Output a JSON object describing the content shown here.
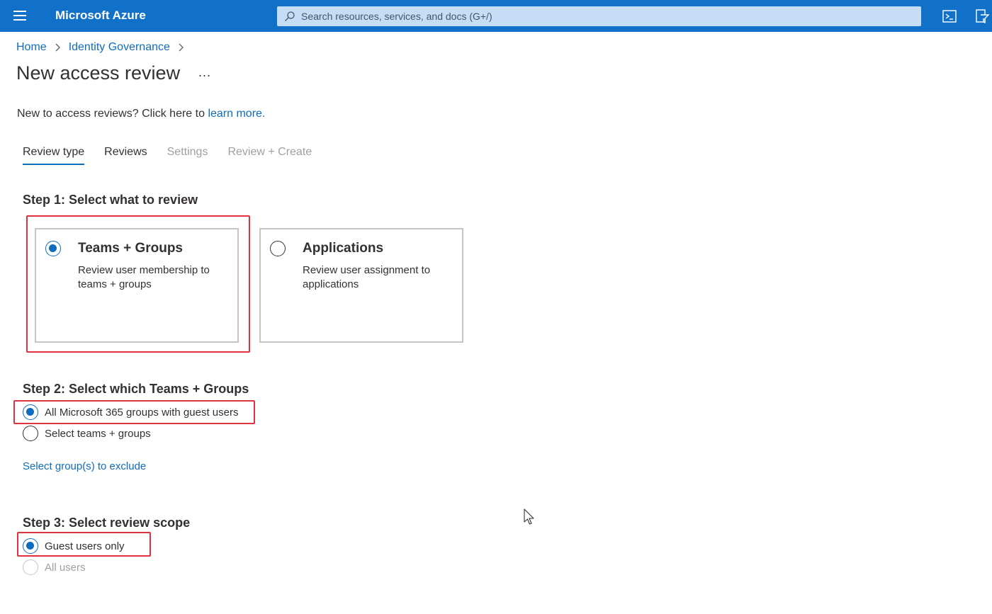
{
  "topbar": {
    "brand": "Microsoft Azure",
    "search_placeholder": "Search resources, services, and docs (G+/)",
    "icons": [
      "hamburger-icon",
      "search-icon",
      "cloud-shell-icon",
      "directory-filter-icon"
    ]
  },
  "breadcrumb": {
    "items": [
      "Home",
      "Identity Governance"
    ]
  },
  "page": {
    "title": "New access review",
    "more_label": "...",
    "intro_text": "New to access reviews? Click here to ",
    "intro_link": "learn more."
  },
  "tabs": [
    {
      "label": "Review type",
      "state": "active"
    },
    {
      "label": "Reviews",
      "state": "enabled"
    },
    {
      "label": "Settings",
      "state": "disabled"
    },
    {
      "label": "Review + Create",
      "state": "disabled"
    }
  ],
  "step1": {
    "title": "Step 1: Select what to review",
    "cards": [
      {
        "title": "Teams + Groups",
        "desc": "Review user membership to teams + groups",
        "selected": true
      },
      {
        "title": "Applications",
        "desc": "Review user assignment to applications",
        "selected": false
      }
    ]
  },
  "step2": {
    "title": "Step 2: Select which Teams + Groups",
    "options": [
      {
        "label": "All Microsoft 365 groups with guest users",
        "selected": true
      },
      {
        "label": "Select teams + groups",
        "selected": false
      }
    ],
    "exclude_link": "Select group(s) to exclude"
  },
  "step3": {
    "title": "Step 3: Select review scope",
    "options": [
      {
        "label": "Guest users only",
        "selected": true
      },
      {
        "label": "All users",
        "selected": false,
        "disabled": true
      }
    ]
  },
  "colors": {
    "topbar": "#1170c8",
    "accent": "#0f6cbd",
    "highlight": "#e0333d",
    "disabled_text": "#a19f9d"
  }
}
